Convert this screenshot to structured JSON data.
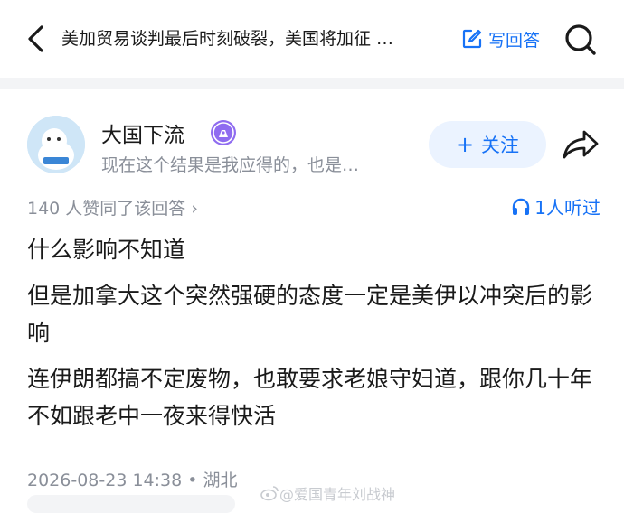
{
  "header": {
    "back_icon": "chevron-left-icon",
    "question_title": "美加贸易谈判最后时刻破裂，美国将加征 …",
    "write_answer_label": "写回答",
    "search_icon": "search-icon"
  },
  "author": {
    "name": "大国下流",
    "bio": "现在这个结果是我应得的，也是…",
    "follow_label": "关注",
    "follow_plus": "+",
    "badge_icon": "pen-badge-icon",
    "share_icon": "share-icon"
  },
  "meta": {
    "votes_text": "140 人赞同了该回答 ›",
    "listen_text": "1人听过"
  },
  "answer": {
    "paragraphs": [
      "什么影响不知道",
      "但是加拿大这个突然强硬的态度一定是美伊以冲突后的影响",
      "连伊朗都搞不定废物，也敢要求老娘守妇道，跟你几十年不如跟老中一夜来得快活"
    ]
  },
  "footer": {
    "timestamp": "2026-08-23 14:38 • 湖北",
    "watermark": "@爱国青年刘战神"
  },
  "colors": {
    "accent": "#1772f6",
    "muted": "#8a8f99",
    "follow_bg": "#ebf3ff",
    "badge_purple": "#8f6cf0"
  }
}
